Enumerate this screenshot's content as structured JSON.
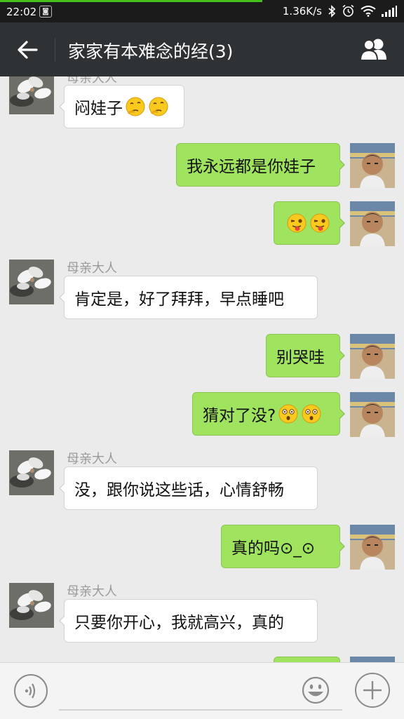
{
  "status_bar": {
    "time": "22:02",
    "network_speed": "1.36K/s",
    "icons": [
      "app-notification-icon",
      "bluetooth-icon",
      "alarm-icon",
      "wifi-icon",
      "signal-icon"
    ]
  },
  "header": {
    "back_icon": "back-arrow-icon",
    "title": "家家有本难念的经(3)",
    "members_icon": "group-members-icon"
  },
  "chat": {
    "messages": [
      {
        "side": "incoming",
        "sender": "母亲大人",
        "text": "闷娃子",
        "emojis": [
          "thinking",
          "thinking"
        ]
      },
      {
        "side": "outgoing",
        "text": "我永远都是你娃子",
        "emojis": []
      },
      {
        "side": "outgoing",
        "text": "",
        "emojis": [
          "tongue-wink",
          "tongue-wink"
        ]
      },
      {
        "side": "incoming",
        "sender": "母亲大人",
        "text": "肯定是，好了拜拜，早点睡吧",
        "emojis": []
      },
      {
        "side": "outgoing",
        "text": "别哭哇",
        "emojis": []
      },
      {
        "side": "outgoing",
        "text": "猜对了没?",
        "emojis": [
          "surprised",
          "surprised"
        ]
      },
      {
        "side": "incoming",
        "sender": "母亲大人",
        "text": "没，跟你说这些话，心情舒畅",
        "emojis": []
      },
      {
        "side": "outgoing",
        "text": "真的吗⊙_⊙",
        "emojis": []
      },
      {
        "side": "incoming",
        "sender": "母亲大人",
        "text": "只要你开心，我就高兴，真的",
        "emojis": []
      }
    ]
  },
  "input_bar": {
    "voice_icon": "voice-input-icon",
    "text_value": "",
    "emoji_icon": "emoji-icon",
    "more_icon": "plus-icon"
  },
  "colors": {
    "status_bar": "#1b1b1b",
    "title_bar": "#2f3235",
    "background": "#ebebeb",
    "outgoing_bubble": "#9fe35f",
    "incoming_bubble": "#ffffff",
    "progress": "#45c01a"
  }
}
